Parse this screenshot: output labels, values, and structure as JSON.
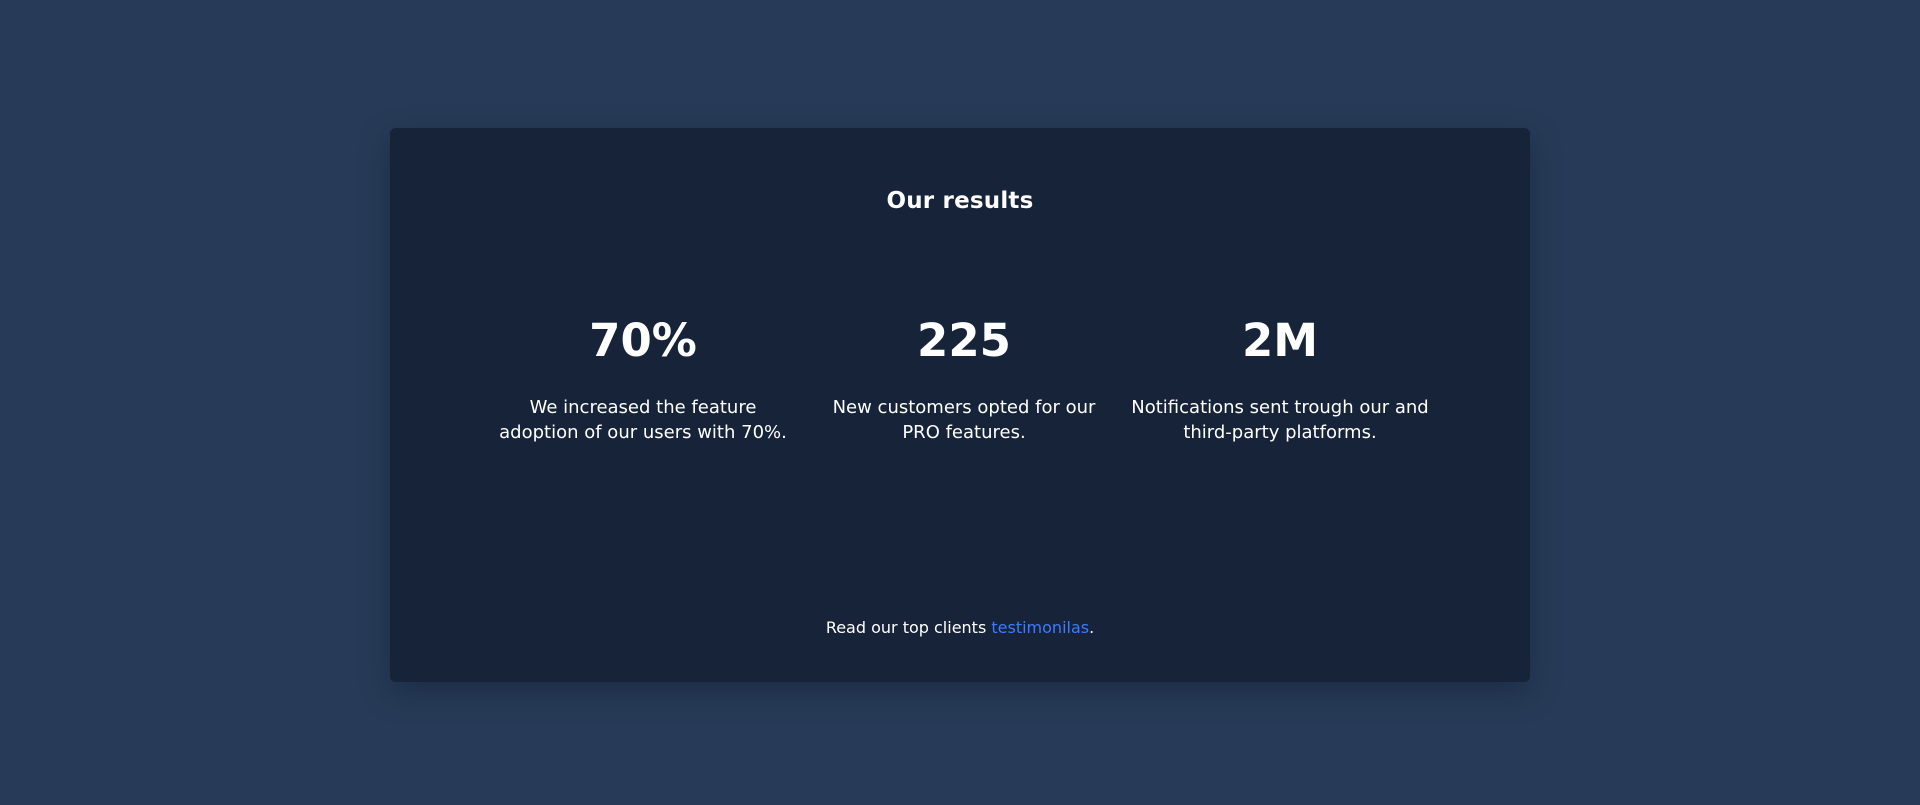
{
  "section": {
    "title": "Our results"
  },
  "stats": [
    {
      "value": "70%",
      "description": "We increased the feature adoption of our users with 70%."
    },
    {
      "value": "225",
      "description": "New customers opted for our PRO features."
    },
    {
      "value": "2M",
      "description": "Notifications sent trough our and third-party platforms."
    }
  ],
  "footer": {
    "text_before": "Read our top clients ",
    "link_text": "testimonilas",
    "text_after": "."
  },
  "colors": {
    "page_background": "#273b58",
    "card_background": "#162338",
    "text": "#ffffff",
    "link": "#3d7cff"
  }
}
